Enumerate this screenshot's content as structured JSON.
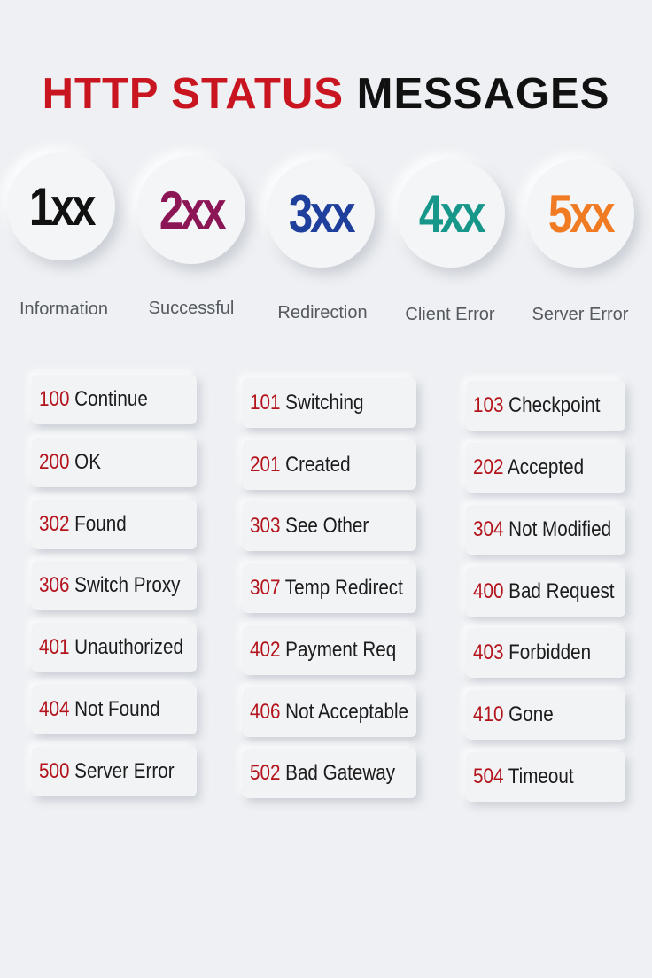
{
  "title": {
    "part1": "HTTP STATUS",
    "part2": "MESSAGES"
  },
  "colors": {
    "title_red": "#c8151f",
    "code_red": "#b3141c",
    "cat_1xx": "#111111",
    "cat_2xx": "#8c1556",
    "cat_3xx": "#1f3f9c",
    "cat_4xx": "#17968a",
    "cat_5xx": "#f07b22"
  },
  "categories": [
    {
      "code": "1xx",
      "label": "Information"
    },
    {
      "code": "2xx",
      "label": "Successful"
    },
    {
      "code": "3xx",
      "label": "Redirection"
    },
    {
      "code": "4xx",
      "label": "Client Error"
    },
    {
      "code": "5xx",
      "label": "Server Error"
    }
  ],
  "columns": [
    [
      {
        "code": "100",
        "text": "Continue"
      },
      {
        "code": "200",
        "text": "OK"
      },
      {
        "code": "302",
        "text": "Found"
      },
      {
        "code": "306",
        "text": "Switch Proxy"
      },
      {
        "code": "401",
        "text": "Unauthorized"
      },
      {
        "code": "404",
        "text": "Not Found"
      },
      {
        "code": "500",
        "text": "Server Error"
      }
    ],
    [
      {
        "code": "101",
        "text": "Switching"
      },
      {
        "code": "201",
        "text": "Created"
      },
      {
        "code": "303",
        "text": "See Other"
      },
      {
        "code": "307",
        "text": "Temp Redirect"
      },
      {
        "code": "402",
        "text": "Payment Req"
      },
      {
        "code": "406",
        "text": "Not Acceptable"
      },
      {
        "code": "502",
        "text": "Bad Gateway"
      }
    ],
    [
      {
        "code": "103",
        "text": "Checkpoint"
      },
      {
        "code": "202",
        "text": "Accepted"
      },
      {
        "code": "304",
        "text": "Not Modified"
      },
      {
        "code": "400",
        "text": "Bad Request"
      },
      {
        "code": "403",
        "text": "Forbidden"
      },
      {
        "code": "410",
        "text": "Gone"
      },
      {
        "code": "504",
        "text": "Timeout"
      }
    ]
  ]
}
